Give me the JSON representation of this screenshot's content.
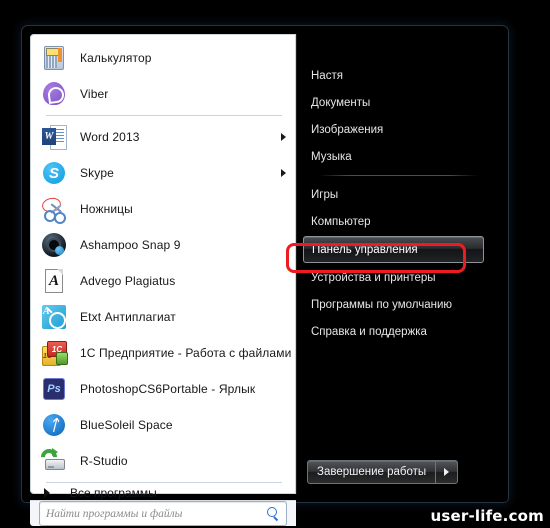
{
  "start_menu": {
    "left_panel": {
      "programs": [
        {
          "label": "Калькулятор",
          "icon": "calculator-icon",
          "has_submenu": false,
          "separator_after": false
        },
        {
          "label": "Viber",
          "icon": "viber-icon",
          "has_submenu": false,
          "separator_after": true
        },
        {
          "label": "Word 2013",
          "icon": "word-icon",
          "has_submenu": true,
          "separator_after": false
        },
        {
          "label": "Skype",
          "icon": "skype-icon",
          "has_submenu": true,
          "separator_after": false
        },
        {
          "label": "Ножницы",
          "icon": "scissors-icon",
          "has_submenu": false,
          "separator_after": false
        },
        {
          "label": "Ashampoo Snap 9",
          "icon": "ashampoo-snap-icon",
          "has_submenu": false,
          "separator_after": false
        },
        {
          "label": "Advego Plagiatus",
          "icon": "advego-plagiatus-icon",
          "has_submenu": false,
          "separator_after": false
        },
        {
          "label": "Etxt Антиплагиат",
          "icon": "etxt-antiplagiat-icon",
          "has_submenu": false,
          "separator_after": false
        },
        {
          "label": "1С Предприятие - Работа с файлами",
          "icon": "1c-enterprise-icon",
          "has_submenu": false,
          "separator_after": false
        },
        {
          "label": "PhotoshopCS6Portable - Ярлык",
          "icon": "photoshop-icon",
          "has_submenu": false,
          "separator_after": false
        },
        {
          "label": "BlueSoleil Space",
          "icon": "bluetooth-icon",
          "has_submenu": false,
          "separator_after": false
        },
        {
          "label": "R-Studio",
          "icon": "r-studio-icon",
          "has_submenu": false,
          "separator_after": true
        }
      ],
      "all_programs_label": "Все программы",
      "search": {
        "placeholder": "Найти программы и файлы",
        "value": "",
        "icon": "search-magnifier-icon"
      }
    },
    "right_panel": {
      "items": [
        {
          "label": "Настя",
          "selected": false,
          "separator_after": false
        },
        {
          "label": "Документы",
          "selected": false,
          "separator_after": false
        },
        {
          "label": "Изображения",
          "selected": false,
          "separator_after": false
        },
        {
          "label": "Музыка",
          "selected": false,
          "separator_after": true
        },
        {
          "label": "Игры",
          "selected": false,
          "separator_after": false
        },
        {
          "label": "Компьютер",
          "selected": false,
          "separator_after": false
        },
        {
          "label": "Панель управления",
          "selected": true,
          "separator_after": false
        },
        {
          "label": "Устройства и принтеры",
          "selected": false,
          "separator_after": false
        },
        {
          "label": "Программы по умолчанию",
          "selected": false,
          "separator_after": false
        },
        {
          "label": "Справка и поддержка",
          "selected": false,
          "separator_after": false
        }
      ],
      "shutdown": {
        "label": "Завершение работы",
        "more_icon": "chevron-right-icon"
      }
    }
  },
  "annotation": {
    "target": "Панель управления",
    "color": "#ee1c22"
  },
  "watermark": {
    "text": "user-life.com"
  }
}
